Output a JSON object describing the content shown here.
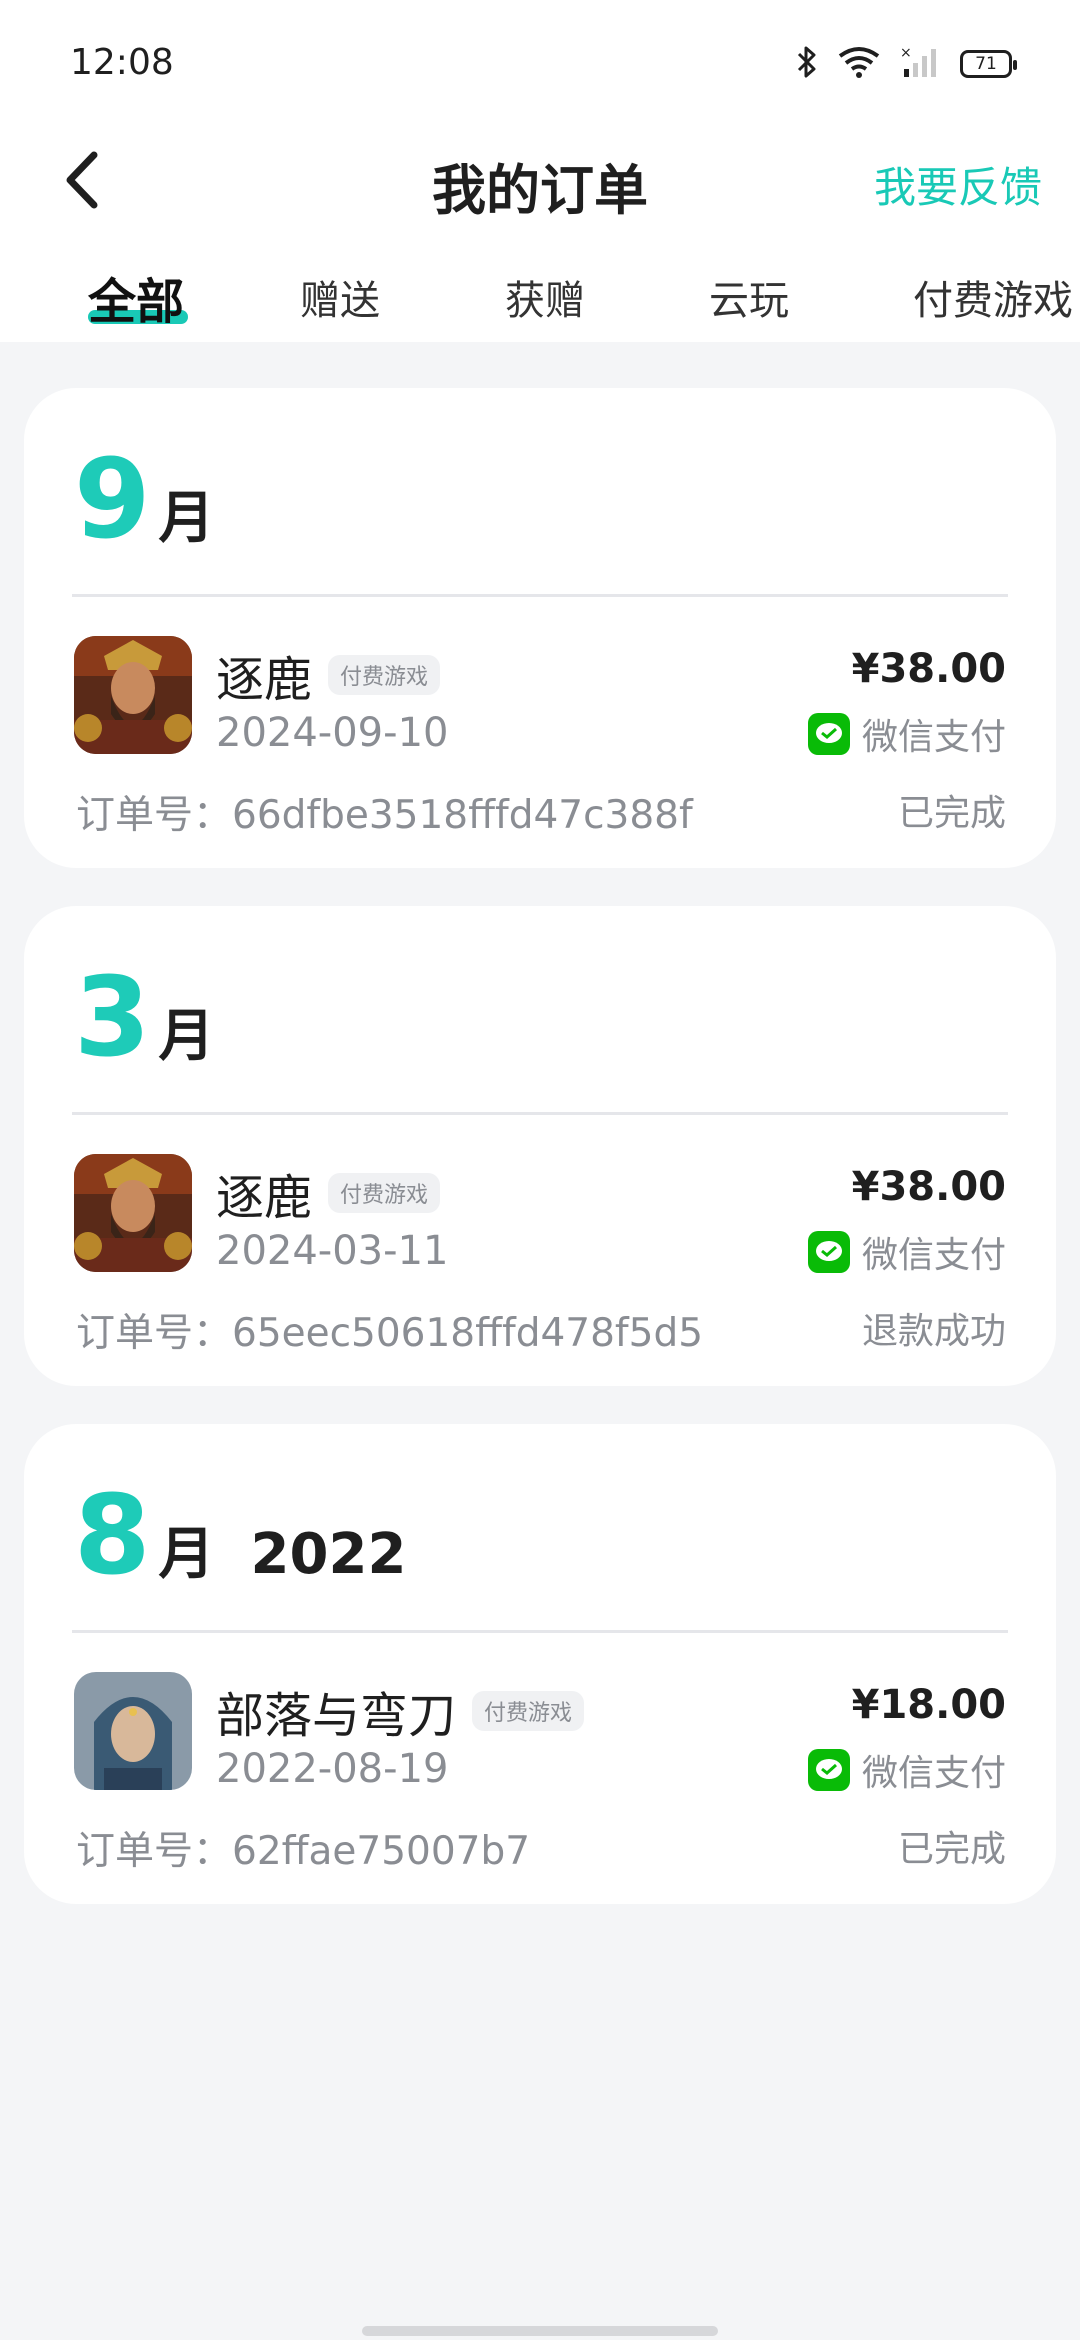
{
  "status_bar": {
    "time": "12:08",
    "battery": "71",
    "icons": [
      "bluetooth-icon",
      "wifi-icon",
      "signal-icon",
      "battery-icon"
    ]
  },
  "header": {
    "title": "我的订单",
    "feedback": "我要反馈",
    "back_icon": "chevron-left-icon"
  },
  "tabs": {
    "items": [
      "全部",
      "赠送",
      "获赠",
      "云玩",
      "付费游戏"
    ],
    "active_index": 0
  },
  "colors": {
    "accent": "#19c9b6",
    "wechat_green": "#09bb07",
    "muted_text": "#8a8d93",
    "background": "#f4f5f7"
  },
  "orders": [
    {
      "month_num": "9",
      "month_unit": "月",
      "year": "",
      "game_name": "逐鹿",
      "tag": "付费游戏",
      "date": "2024-09-10",
      "price": "¥38.00",
      "payment": "微信支付",
      "order_no": "订单号：66dfbe3518fffd47c388f",
      "status": "已完成",
      "icon": "warrior-portrait-icon"
    },
    {
      "month_num": "3",
      "month_unit": "月",
      "year": "",
      "game_name": "逐鹿",
      "tag": "付费游戏",
      "date": "2024-03-11",
      "price": "¥38.00",
      "payment": "微信支付",
      "order_no": "订单号：65eec50618fffd478f5d5",
      "status": "退款成功",
      "icon": "warrior-portrait-icon"
    },
    {
      "month_num": "8",
      "month_unit": "月",
      "year": "2022",
      "game_name": "部落与弯刀",
      "tag": "付费游戏",
      "date": "2022-08-19",
      "price": "¥18.00",
      "payment": "微信支付",
      "order_no": "订单号：62ffae75007b7",
      "status": "已完成",
      "icon": "hooded-woman-portrait-icon"
    }
  ]
}
